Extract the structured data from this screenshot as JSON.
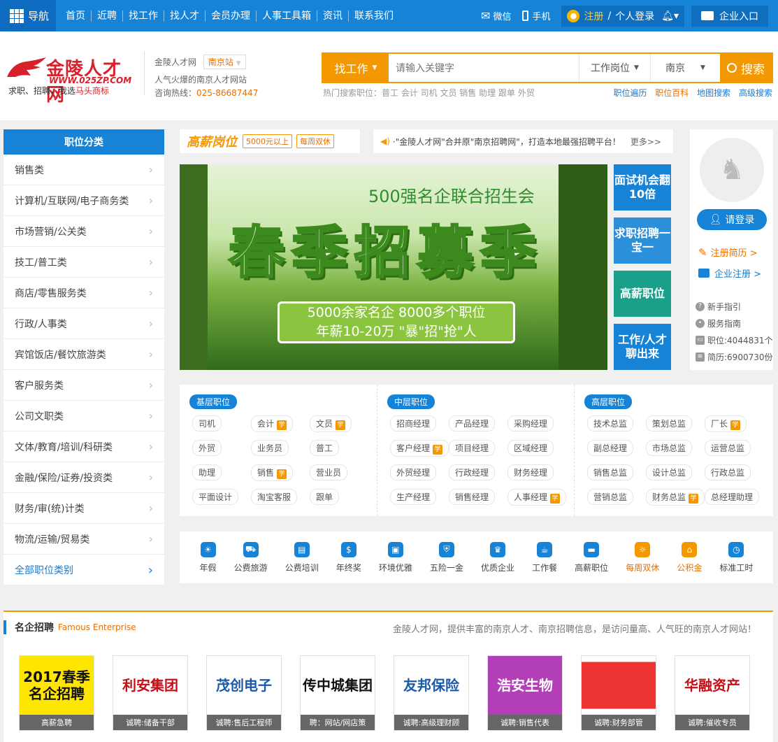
{
  "topbar": {
    "nav_toggle": "导航",
    "nav": [
      "首页",
      "近聘",
      "找工作",
      "找人才",
      "会员办理",
      "人事工具箱",
      "资讯",
      "联系我们"
    ],
    "wechat": "微信",
    "mobile": "手机",
    "register": "注册",
    "slash": "/",
    "login": "个人登录",
    "enterprise": "企业入口"
  },
  "header": {
    "logo_name": "金陵人才网",
    "logo_url": "WWW.025ZP.COM",
    "logo_slogan_a": "求职、招聘，我选",
    "logo_slogan_b": "马头商标",
    "site_name": "金陵人才网",
    "city": "南京站",
    "tagline": "人气火爆的南京人才网站",
    "hotline_label": "咨询热线：",
    "hotline": "025-86687447"
  },
  "search": {
    "type": "找工作",
    "placeholder": "请输入关键字",
    "filter1": "工作岗位",
    "filter2": "南京",
    "button": "搜索",
    "hot_label": "热门搜索职位：",
    "hot": "普工 会计 司机 文员 销售 助理 跟单 外贸",
    "links": [
      "职位遍历",
      "职位百科",
      "地图搜索",
      "高级搜索"
    ]
  },
  "categories": {
    "title": "职位分类",
    "items": [
      "销售类",
      "计算机/互联网/电子商务类",
      "市场营销/公关类",
      "技工/普工类",
      "商店/零售服务类",
      "行政/人事类",
      "宾馆饭店/餐饮旅游类",
      "客户服务类",
      "公司文职类",
      "文体/教育/培训/科研类",
      "金融/保险/证券/投资类",
      "财务/审(统)计类",
      "物流/运输/贸易类"
    ],
    "all": "全部职位类别"
  },
  "promo": {
    "title": "高薪岗位",
    "tag1": "5000元以上",
    "tag2": "每周双休",
    "notice": "·\"金陵人才网\"合并原\"南京招聘网\"，打造本地最强招聘平台！",
    "more": "更多>>"
  },
  "banner": {
    "sub": "500强名企联合招生会",
    "main": "春季招募季",
    "line1": "5000余家名企  8000多个职位",
    "line2": "年薪10-20万  \"暴\"招\"抢\"人"
  },
  "tiles": [
    {
      "text": "面试机会翻10倍",
      "color": "#1783d6"
    },
    {
      "text": "求职招聘一宝一",
      "color": "#2b8fd9"
    },
    {
      "text": "高薪职位",
      "color": "#1aa08a"
    },
    {
      "text": "工作/人才聊出来",
      "color": "#1783d6"
    }
  ],
  "rpanel": {
    "login": "请登录",
    "resume": "注册简历 >",
    "company": "企业注册 >",
    "guide": "新手指引",
    "service": "服务指南",
    "jobs": "职位:4044831个",
    "resumes": "简历:6900730份"
  },
  "levels": [
    {
      "title": "基层职位",
      "tags": [
        [
          "司机",
          false
        ],
        [
          "会计",
          true
        ],
        [
          "文员",
          true
        ],
        [
          "外贸",
          false
        ],
        [
          "业务员",
          false
        ],
        [
          "普工",
          false
        ],
        [
          "助理",
          false
        ],
        [
          "销售",
          true
        ],
        [
          "营业员",
          false
        ],
        [
          "平面设计",
          false
        ],
        [
          "淘宝客服",
          false
        ],
        [
          "跟单",
          false
        ]
      ]
    },
    {
      "title": "中层职位",
      "tags": [
        [
          "招商经理",
          false
        ],
        [
          "产品经理",
          false
        ],
        [
          "采购经理",
          false
        ],
        [
          "客户经理",
          true
        ],
        [
          "项目经理",
          false
        ],
        [
          "区域经理",
          false
        ],
        [
          "外贸经理",
          false
        ],
        [
          "行政经理",
          false
        ],
        [
          "财务经理",
          false
        ],
        [
          "生产经理",
          false
        ],
        [
          "销售经理",
          false
        ],
        [
          "人事经理",
          true
        ]
      ]
    },
    {
      "title": "高层职位",
      "tags": [
        [
          "技术总监",
          false
        ],
        [
          "策划总监",
          false
        ],
        [
          "厂长",
          true
        ],
        [
          "副总经理",
          false
        ],
        [
          "市场总监",
          false
        ],
        [
          "运营总监",
          false
        ],
        [
          "销售总监",
          false
        ],
        [
          "设计总监",
          false
        ],
        [
          "行政总监",
          false
        ],
        [
          "营销总监",
          false
        ],
        [
          "财务总监",
          true
        ],
        [
          "总经理助理",
          false
        ]
      ]
    }
  ],
  "xue_label": "学",
  "welfare": [
    {
      "label": "年假",
      "icon": "palm-icon",
      "glyph": "☀",
      "highlight": false
    },
    {
      "label": "公费旅游",
      "icon": "bus-icon",
      "glyph": "⛟",
      "highlight": false
    },
    {
      "label": "公费培训",
      "icon": "board-icon",
      "glyph": "▤",
      "highlight": false
    },
    {
      "label": "年终奖",
      "icon": "bag-icon",
      "glyph": "$",
      "highlight": false
    },
    {
      "label": "环境优雅",
      "icon": "picture-icon",
      "glyph": "▣",
      "highlight": false
    },
    {
      "label": "五险一金",
      "icon": "shield-icon",
      "glyph": "⛨",
      "highlight": false
    },
    {
      "label": "优质企业",
      "icon": "trophy-icon",
      "glyph": "♛",
      "highlight": false
    },
    {
      "label": "工作餐",
      "icon": "cup-icon",
      "glyph": "☕",
      "highlight": false
    },
    {
      "label": "高薪职位",
      "icon": "card-icon",
      "glyph": "▬",
      "highlight": false
    },
    {
      "label": "每周双休",
      "icon": "sun-icon",
      "glyph": "☼",
      "highlight": true
    },
    {
      "label": "公积金",
      "icon": "house-icon",
      "glyph": "⌂",
      "highlight": true
    },
    {
      "label": "标准工时",
      "icon": "clock-icon",
      "glyph": "◷",
      "highlight": false
    }
  ],
  "famous": {
    "title": "名企招聘",
    "title_en": "Famous Enterprise",
    "desc": "金陵人才网，提供丰富的南京人才、南京招聘信息，是访问量高、人气旺的南京人才网站！",
    "items": [
      {
        "logo": "2017春季名企招聘",
        "caption": "高薪急聘",
        "bg": "#ffe600",
        "fg": "#111"
      },
      {
        "logo": "利安集团",
        "caption": "诚聘:储备干部",
        "bg": "#fff",
        "fg": "#c40d14"
      },
      {
        "logo": "茂创电子",
        "caption": "诚聘:售后工程师",
        "bg": "#fff",
        "fg": "#1a5aa8"
      },
      {
        "logo": "传中城集团",
        "caption": "聘：网站/网店策",
        "bg": "#fff",
        "fg": "#111"
      },
      {
        "logo": "友邦保险",
        "caption": "诚聘:高级理财顾",
        "bg": "#fff",
        "fg": "#1a5aa8"
      },
      {
        "logo": "浩安生物",
        "caption": "诚聘:销售代表",
        "bg": "#b23fb6",
        "fg": "#fff"
      },
      {
        "logo": "",
        "caption": "诚聘:财务部管",
        "bg": "#fff",
        "fg": "#c40d14"
      },
      {
        "logo": "华融资产",
        "caption": "诚聘:催收专员",
        "bg": "#fff",
        "fg": "#c40d14"
      }
    ]
  }
}
